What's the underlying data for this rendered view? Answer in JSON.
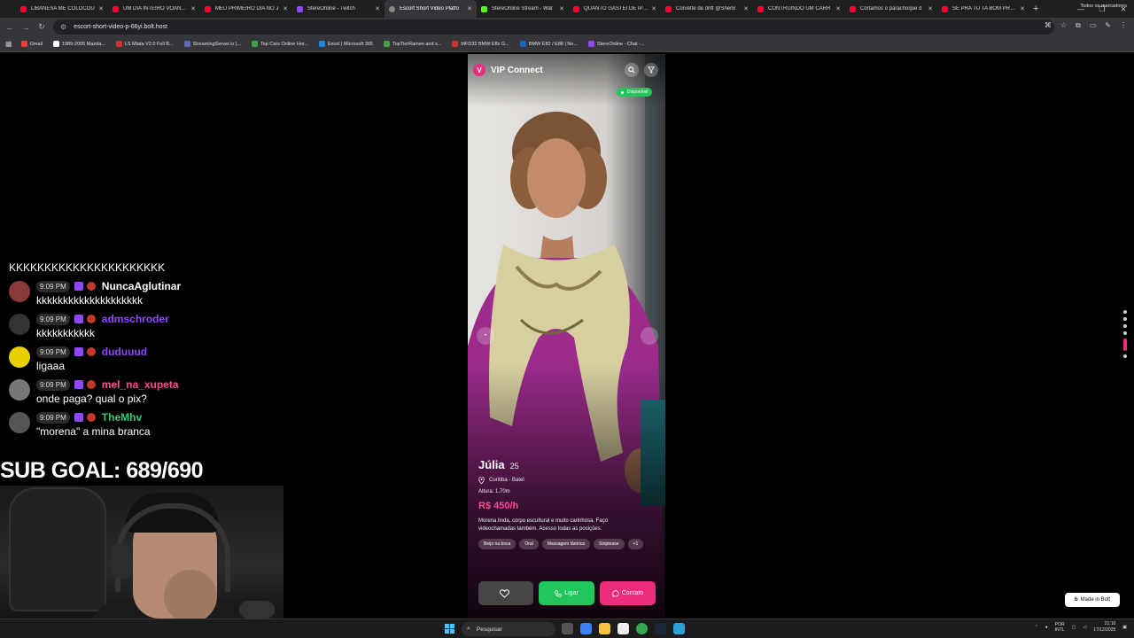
{
  "browser": {
    "tabs": [
      {
        "label": "LIBANESA ME COLOCOU",
        "favicon": "youtube"
      },
      {
        "label": "UM DIA INTEIRO VOANDO",
        "favicon": "youtube"
      },
      {
        "label": "MEU PRIMEIRO DIA NO J",
        "favicon": "youtube"
      },
      {
        "label": "StereOnline - Twitch",
        "favicon": "twitch"
      },
      {
        "label": "Escort Short Video Platfo",
        "favicon": "globe"
      },
      {
        "label": "StereOnline Stream - Wat",
        "favicon": "kick"
      },
      {
        "label": "QUANTO GASTEI DE IPVA",
        "favicon": "youtube"
      },
      {
        "label": "Corvette de drift @SherB",
        "favicon": "youtube"
      },
      {
        "label": "CONTRUINDO UM CARR",
        "favicon": "youtube"
      },
      {
        "label": "Cortamos o parachoque d",
        "favicon": "youtube"
      },
      {
        "label": "SE PRA TU TA BOM PRA B",
        "favicon": "youtube"
      }
    ],
    "active_tab_index": 4,
    "url": "escort-short-video-p-66yi.bolt.host",
    "bookmarks": [
      {
        "label": "Gmail",
        "color": "#ea4335"
      },
      {
        "label": "1989-2005 Mazda...",
        "color": "#ffffff"
      },
      {
        "label": "LS Miata V2.0 Full B...",
        "color": "#d32f2f"
      },
      {
        "label": "StreamingServer.io |...",
        "color": "#5c6bc0"
      },
      {
        "label": "Top Cars Online Hor...",
        "color": "#43a047"
      },
      {
        "label": "Excel | Microsoft 365",
        "color": "#1e88e5"
      },
      {
        "label": "TopTierRamen and s...",
        "color": "#43a047"
      },
      {
        "label": "MFD32 BMW E8x G...",
        "color": "#d32f2f"
      },
      {
        "label": "BMW E82 / E88 | No...",
        "color": "#1565c0"
      },
      {
        "label": "StereOnline - Chat -...",
        "color": "#9146ff"
      }
    ],
    "all_bookmarks_label": "Todos os marcadores"
  },
  "chat": {
    "top_line": "KKKKKKKKKKKKKKKKKKKKKK",
    "messages": [
      {
        "time": "9:09 PM",
        "user": "NuncaAglutinar",
        "color": "#ffffff",
        "text": "kkkkkkkkkkkkkkkkkkkk",
        "avatar": "#8b3a3a"
      },
      {
        "time": "9:09 PM",
        "user": "admschroder",
        "color": "#9146ff",
        "text": "kkkkkkkkkkk",
        "avatar": "#333333"
      },
      {
        "time": "9:09 PM",
        "user": "duduuud",
        "color": "#9146ff",
        "text": "ligaaa",
        "avatar": "#e6d000"
      },
      {
        "time": "9:09 PM",
        "user": "mel_na_xupeta",
        "color": "#ff4d94",
        "text": "onde paga? qual o pix?",
        "avatar": "#777777"
      },
      {
        "time": "9:09 PM",
        "user": "TheMhv",
        "color": "#2ecc71",
        "text": "\"morena\" a mina branca",
        "avatar": "#555555"
      }
    ]
  },
  "overlay": {
    "sub_goal": "SUB GOAL: 689/690"
  },
  "app": {
    "logo_letter": "V",
    "title": "VIP Connect",
    "availability": "Disponível",
    "profile": {
      "name": "Júlia",
      "age": "25",
      "location": "Curitiba - Batel",
      "height": "Altura: 1,70m",
      "price": "R$ 450/h",
      "description": "Morena linda, corpo escultural e muito carinhosa. Faço videochamadas também. Acesso todas as posições.",
      "tags": [
        "Beijo na boca",
        "Oral",
        "Massagem tântrica",
        "Striptease",
        "+1"
      ]
    },
    "actions": {
      "call_label": "Ligar",
      "contact_label": "Contato"
    },
    "accent_color": "#ec2c7c"
  },
  "made_in_bolt": "Made in Bolt",
  "taskbar": {
    "search_placeholder": "Pesquisar",
    "lang_top": "POR",
    "lang_bottom": "INTL",
    "time": "21:10",
    "date": "17/12/2025"
  }
}
